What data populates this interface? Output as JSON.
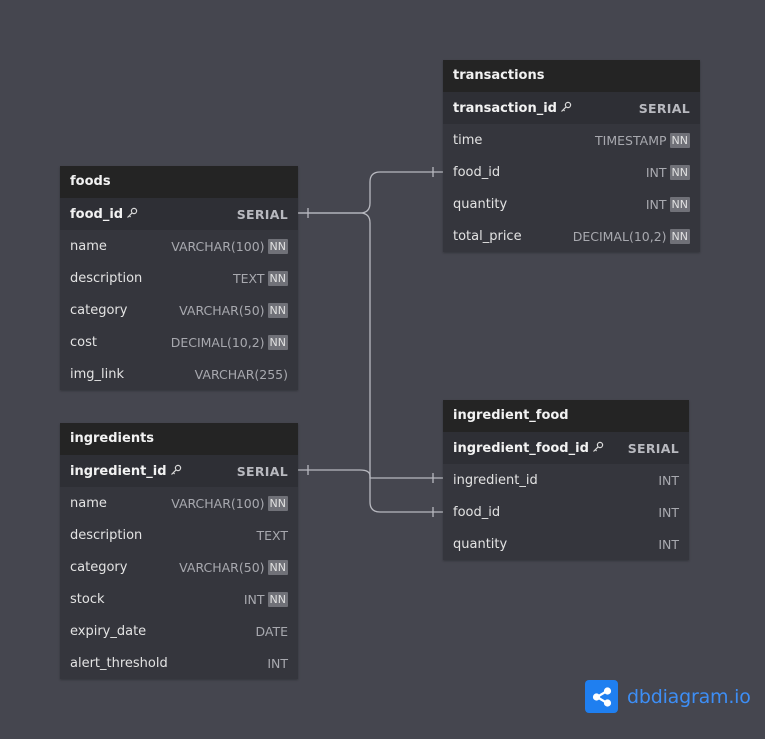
{
  "tables": [
    {
      "id": "foods",
      "title": "foods",
      "fields": [
        {
          "name": "food_id",
          "type": "SERIAL",
          "pk": true,
          "nn": false
        },
        {
          "name": "name",
          "type": "VARCHAR(100)",
          "pk": false,
          "nn": true
        },
        {
          "name": "description",
          "type": "TEXT",
          "pk": false,
          "nn": true
        },
        {
          "name": "category",
          "type": "VARCHAR(50)",
          "pk": false,
          "nn": true
        },
        {
          "name": "cost",
          "type": "DECIMAL(10,2)",
          "pk": false,
          "nn": true
        },
        {
          "name": "img_link",
          "type": "VARCHAR(255)",
          "pk": false,
          "nn": false
        }
      ]
    },
    {
      "id": "ingredients",
      "title": "ingredients",
      "fields": [
        {
          "name": "ingredient_id",
          "type": "SERIAL",
          "pk": true,
          "nn": false
        },
        {
          "name": "name",
          "type": "VARCHAR(100)",
          "pk": false,
          "nn": true
        },
        {
          "name": "description",
          "type": "TEXT",
          "pk": false,
          "nn": false
        },
        {
          "name": "category",
          "type": "VARCHAR(50)",
          "pk": false,
          "nn": true
        },
        {
          "name": "stock",
          "type": "INT",
          "pk": false,
          "nn": true
        },
        {
          "name": "expiry_date",
          "type": "DATE",
          "pk": false,
          "nn": false
        },
        {
          "name": "alert_threshold",
          "type": "INT",
          "pk": false,
          "nn": false
        }
      ]
    },
    {
      "id": "transactions",
      "title": "transactions",
      "fields": [
        {
          "name": "transaction_id",
          "type": "SERIAL",
          "pk": true,
          "nn": false
        },
        {
          "name": "time",
          "type": "TIMESTAMP",
          "pk": false,
          "nn": true
        },
        {
          "name": "food_id",
          "type": "INT",
          "pk": false,
          "nn": true
        },
        {
          "name": "quantity",
          "type": "INT",
          "pk": false,
          "nn": true
        },
        {
          "name": "total_price",
          "type": "DECIMAL(10,2)",
          "pk": false,
          "nn": true
        }
      ]
    },
    {
      "id": "ingredient_food",
      "title": "ingredient_food",
      "fields": [
        {
          "name": "ingredient_food_id",
          "type": "SERIAL",
          "pk": true,
          "nn": false
        },
        {
          "name": "ingredient_id",
          "type": "INT",
          "pk": false,
          "nn": false
        },
        {
          "name": "food_id",
          "type": "INT",
          "pk": false,
          "nn": false
        },
        {
          "name": "quantity",
          "type": "INT",
          "pk": false,
          "nn": false
        }
      ]
    }
  ],
  "relationships": [
    {
      "from": "foods.food_id",
      "to": "transactions.food_id"
    },
    {
      "from": "foods.food_id",
      "to": "ingredient_food.food_id"
    },
    {
      "from": "ingredients.ingredient_id",
      "to": "ingredient_food.ingredient_id"
    }
  ],
  "nn_label": "NN",
  "brand": {
    "name": "dbdiagram.io"
  },
  "colors": {
    "background": "#45464f",
    "table_header": "#242424",
    "table_body": "#35363d",
    "connector": "#b7b8bf",
    "brand": "#1f7ff0"
  }
}
